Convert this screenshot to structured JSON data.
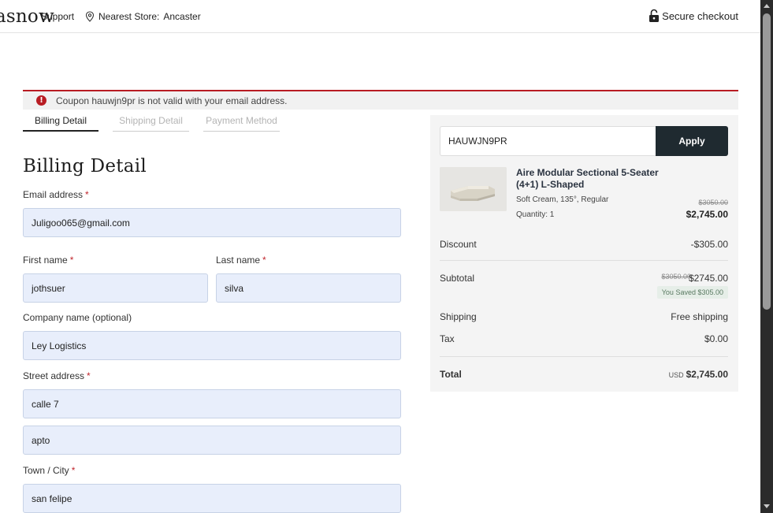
{
  "header": {
    "logo": "asnow",
    "support_label": "Support",
    "nearest_store_label": "Nearest Store:",
    "nearest_store_name": "Ancaster",
    "secure_checkout_label": "Secure checkout"
  },
  "notice": {
    "message": "Coupon hauwjn9pr is not valid with your email address.",
    "icon": "!",
    "color": "#b81c23"
  },
  "tabs": [
    {
      "label": "Billing Detail",
      "active": true
    },
    {
      "label": "Shipping Detail",
      "active": false
    },
    {
      "label": "Payment Method",
      "active": false
    }
  ],
  "form": {
    "title": "Billing Detail",
    "required_marker": "*",
    "email": {
      "label": "Email address",
      "value": "Juligoo065@gmail.com"
    },
    "first_name": {
      "label": "First name",
      "value": "jothsuer"
    },
    "last_name": {
      "label": "Last name",
      "value": "silva"
    },
    "company": {
      "label": "Company name (optional)",
      "value": "Ley Logistics"
    },
    "street": {
      "label": "Street address",
      "value": "calle 7",
      "value2": "apto"
    },
    "city": {
      "label": "Town / City",
      "value": "san felipe"
    }
  },
  "summary": {
    "coupon_value": "HAUWJN9PR",
    "apply_label": "Apply",
    "product": {
      "name": "Aire Modular Sectional 5-Seater (4+1) L-Shaped",
      "variant": "Soft Cream, 135°, Regular",
      "quantity": "Quantity: 1",
      "old_price": "$3050.00",
      "price": "$2,745.00"
    },
    "discount_label": "Discount",
    "discount_value": "-$305.00",
    "subtotal_label": "Subtotal",
    "subtotal_old": "$3050.00",
    "subtotal_value": "$2745.00",
    "saved_label": "You Saved $305.00",
    "shipping_label": "Shipping",
    "shipping_value": "Free shipping",
    "tax_label": "Tax",
    "tax_value": "$0.00",
    "total_label": "Total",
    "total_currency": "USD",
    "total_value": "$2,745.00"
  },
  "colors": {
    "accent": "#1f2a30",
    "error": "#b81c23",
    "field_bg": "#e8eefb"
  }
}
